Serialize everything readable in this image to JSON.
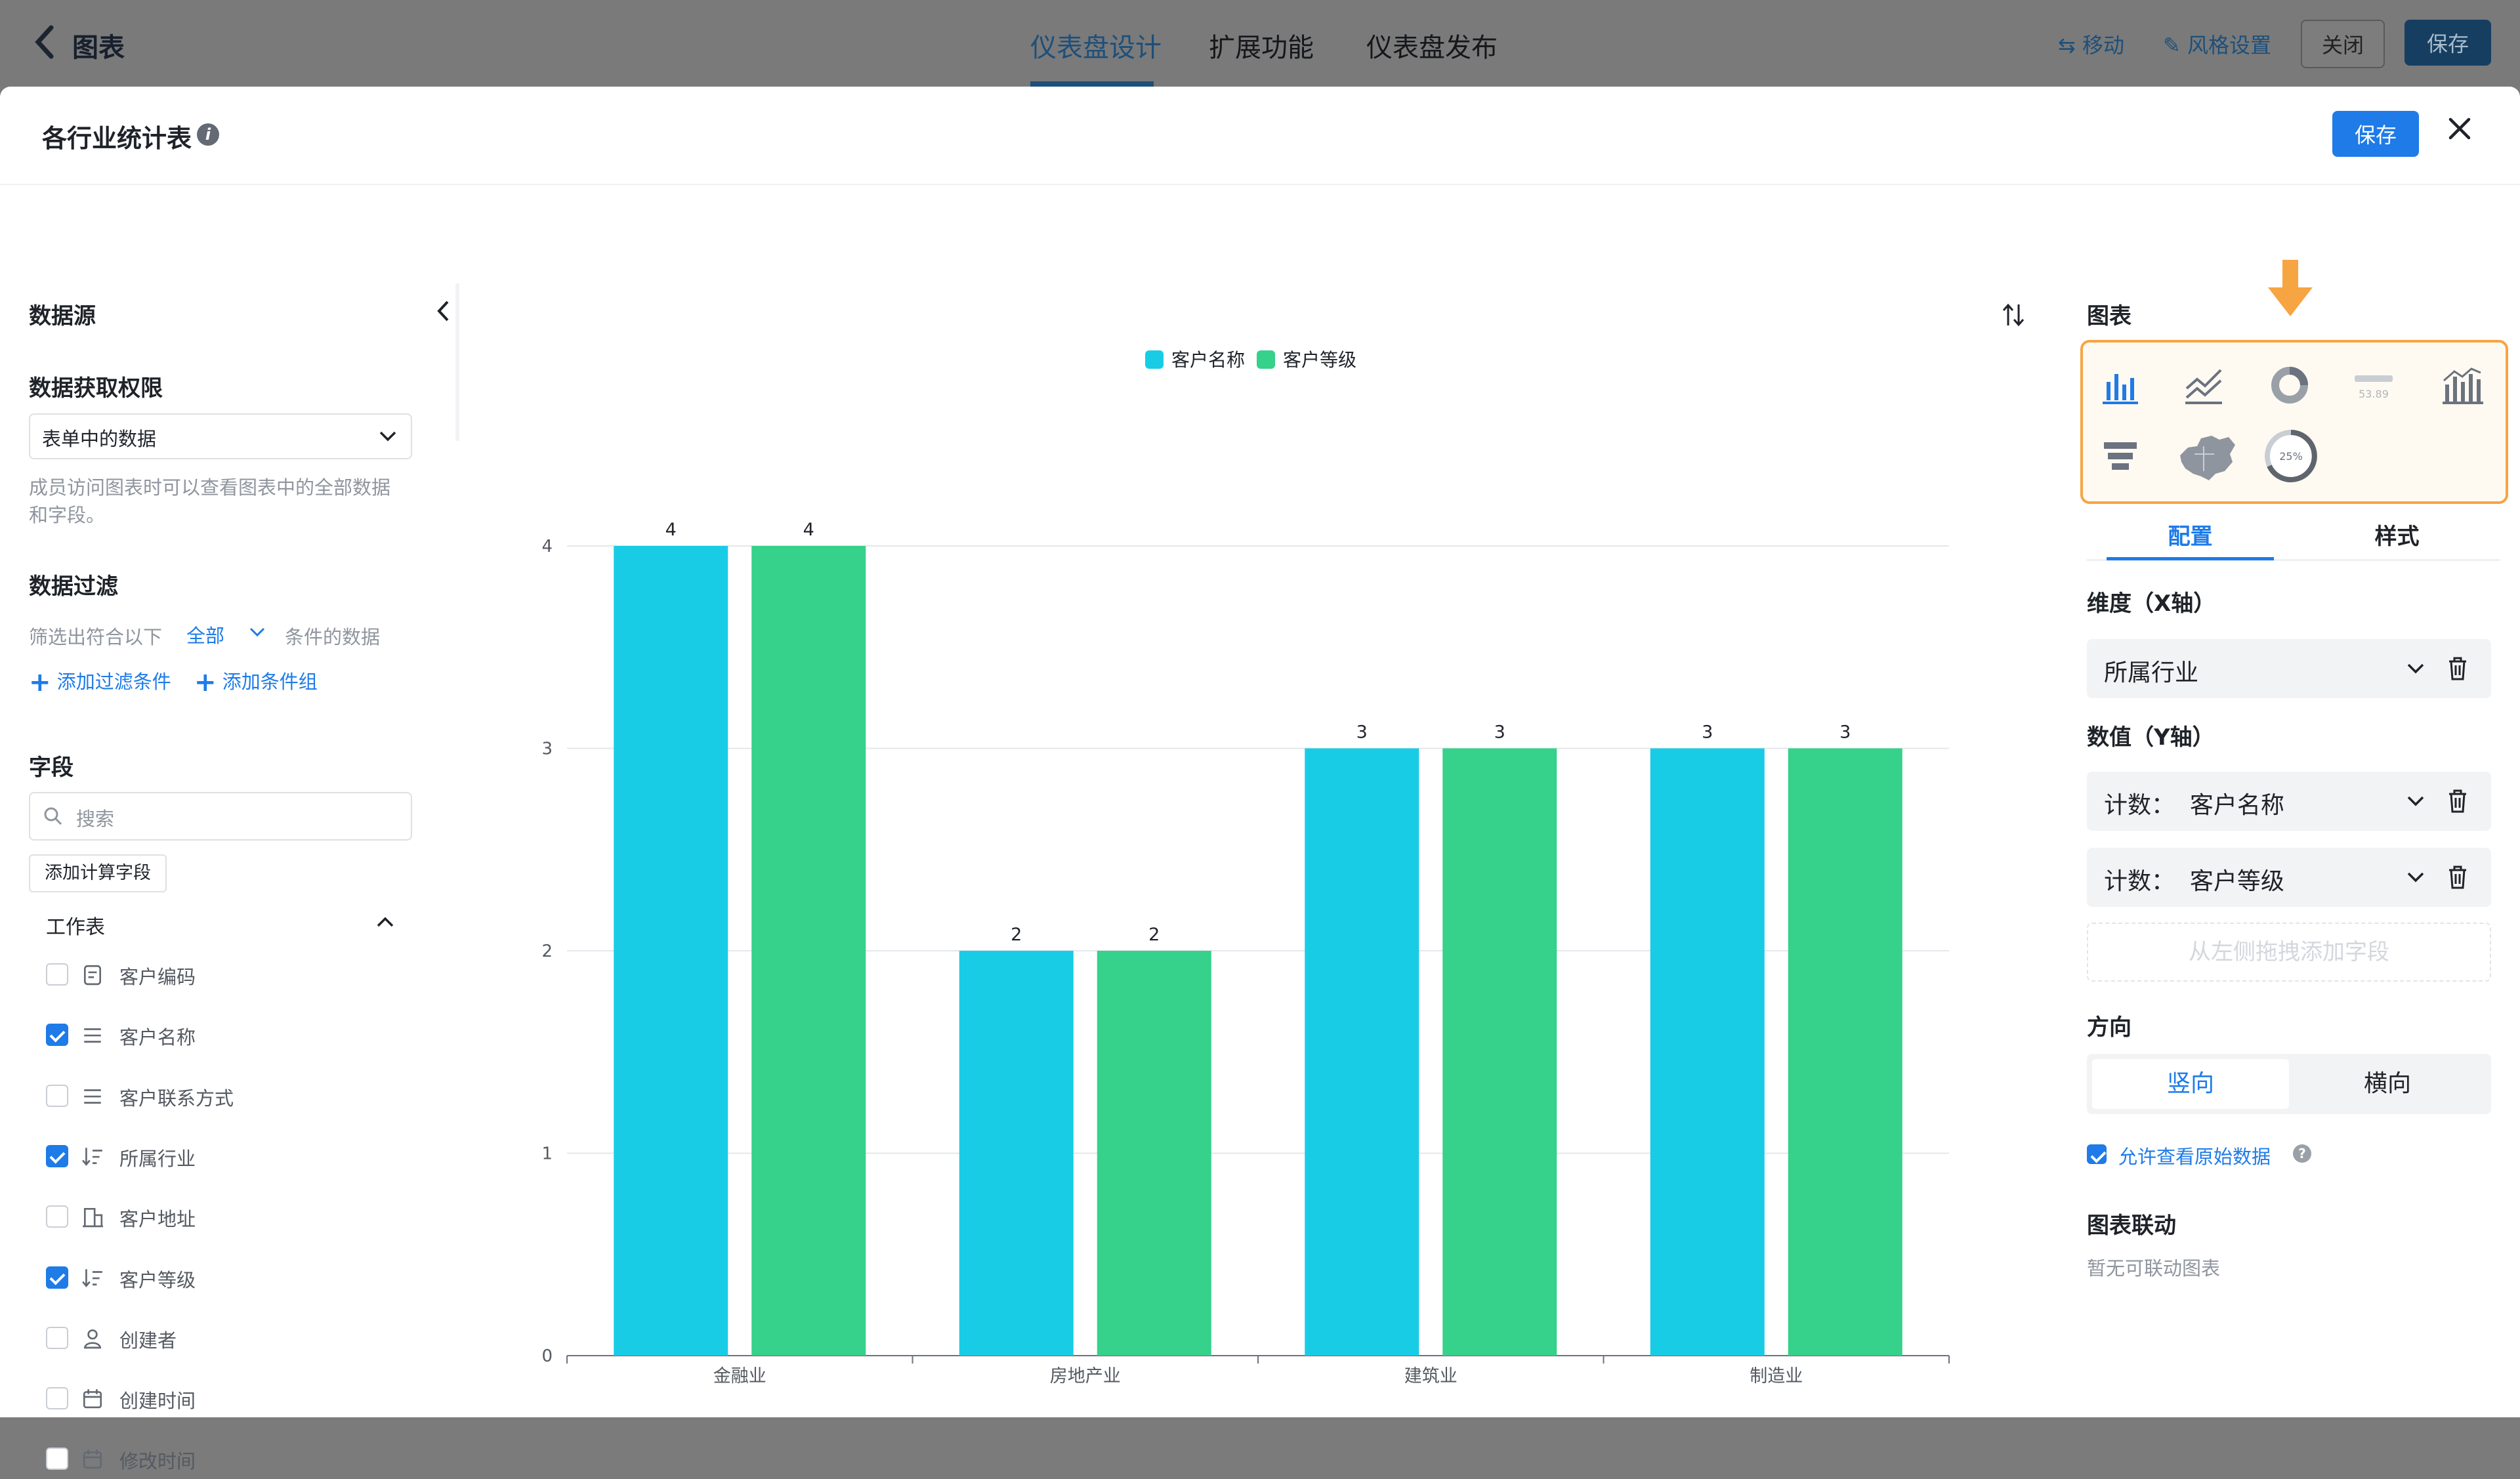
{
  "topbar": {
    "back_title": "图表",
    "tabs": [
      {
        "label": "仪表盘设计",
        "active": true
      },
      {
        "label": "扩展功能",
        "active": false
      },
      {
        "label": "仪表盘发布",
        "active": false
      }
    ],
    "move_label": "移动",
    "style_label": "风格设置",
    "close_label": "关闭",
    "save_label": "保存"
  },
  "modal": {
    "title": "各行业统计表",
    "info_icon": "info-icon",
    "save_label": "保存",
    "close_icon": "close-icon"
  },
  "left_panel": {
    "datasource_title": "数据源",
    "permission_title": "数据获取权限",
    "permission_value": "表单中的数据",
    "permission_hint": "成员访问图表时可以查看图表中的全部数据和字段。",
    "filter_title": "数据过滤",
    "filter_prefix": "筛选出符合以下",
    "filter_mode": "全部",
    "filter_suffix": "条件的数据",
    "add_filter": "添加过滤条件",
    "add_group": "添加条件组",
    "fields_title": "字段",
    "search_placeholder": "搜索",
    "add_calc_field": "添加计算字段",
    "group_label": "工作表",
    "fields": [
      {
        "label": "客户编码",
        "checked": false,
        "icon": "serial-number-icon"
      },
      {
        "label": "客户名称",
        "checked": true,
        "icon": "text-lines-icon"
      },
      {
        "label": "客户联系方式",
        "checked": false,
        "icon": "text-lines-icon"
      },
      {
        "label": "所属行业",
        "checked": true,
        "icon": "sort-list-icon"
      },
      {
        "label": "客户地址",
        "checked": false,
        "icon": "building-icon"
      },
      {
        "label": "客户等级",
        "checked": true,
        "icon": "sort-list-icon"
      },
      {
        "label": "创建者",
        "checked": false,
        "icon": "person-icon"
      },
      {
        "label": "创建时间",
        "checked": false,
        "icon": "calendar-icon"
      },
      {
        "label": "修改时间",
        "checked": false,
        "icon": "calendar-icon"
      }
    ]
  },
  "right_panel": {
    "chart_title": "图表",
    "chart_types": [
      {
        "name": "bar-chart-icon"
      },
      {
        "name": "line-chart-icon"
      },
      {
        "name": "pie-chart-icon"
      },
      {
        "name": "indicator-card-icon",
        "sample_text": "53.89"
      },
      {
        "name": "combo-chart-icon"
      },
      {
        "name": "funnel-chart-icon"
      },
      {
        "name": "china-map-icon"
      },
      {
        "name": "gauge-chart-icon",
        "sample_text": "25%"
      }
    ],
    "tabs": [
      {
        "label": "配置",
        "active": true
      },
      {
        "label": "样式",
        "active": false
      }
    ],
    "x_axis_title": "维度（X轴）",
    "x_field": "所属行业",
    "y_axis_title": "数值（Y轴）",
    "y_fields": [
      "计数：  客户名称",
      "计数：  客户等级"
    ],
    "drop_hint": "从左侧拖拽添加字段",
    "direction_title": "方向",
    "direction_options": [
      {
        "label": "竖向",
        "active": true
      },
      {
        "label": "横向",
        "active": false
      }
    ],
    "allow_raw_label": "允许查看原始数据",
    "linkage_title": "图表联动",
    "linkage_hint": "暂无可联动图表",
    "accent_color": "#1e7be8",
    "highlight_color": "#f7a443"
  },
  "chart_data": {
    "type": "bar",
    "categories": [
      "金融业",
      "房地产业",
      "建筑业",
      "制造业"
    ],
    "series": [
      {
        "name": "客户名称",
        "values": [
          4,
          2,
          3,
          3
        ],
        "color": "#18cce6"
      },
      {
        "name": "客户等级",
        "values": [
          4,
          2,
          3,
          3
        ],
        "color": "#36d18a"
      }
    ],
    "ylim": [
      0,
      4
    ],
    "yticks": [
      0,
      1,
      2,
      3,
      4
    ],
    "grid": true,
    "legend": "top-center",
    "data_labels": true
  }
}
